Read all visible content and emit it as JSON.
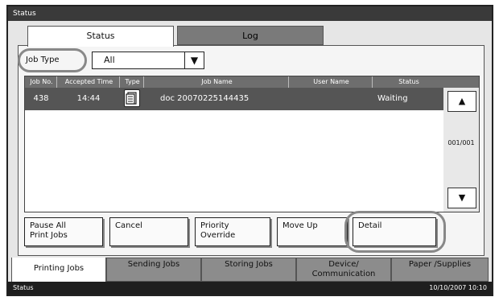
{
  "title": "Status",
  "tabs": [
    {
      "label": "Status",
      "active": true
    },
    {
      "label": "Log",
      "active": false
    }
  ],
  "filter": {
    "label": "Job Type",
    "value": "All",
    "arrow": "▼"
  },
  "table": {
    "headers": [
      "Job No.",
      "Accepted Time",
      "Type",
      "Job Name",
      "User Name",
      "Status"
    ],
    "rows": [
      {
        "job_no": "438",
        "time": "14:44",
        "type_icon": "document-icon",
        "job_name": "doc 20070225144435",
        "user": "",
        "status": "Waiting"
      }
    ]
  },
  "scroll": {
    "up": "▲",
    "down": "▼",
    "page": "001/001"
  },
  "actions": {
    "pause_all": "Pause All\nPrint Jobs",
    "cancel": "Cancel",
    "priority": "Priority\nOverride",
    "move_up": "Move Up",
    "detail": "Detail"
  },
  "bottom_tabs": [
    {
      "label": "Printing Jobs",
      "active": true
    },
    {
      "label": "Sending Jobs",
      "active": false
    },
    {
      "label": "Storing Jobs",
      "active": false
    },
    {
      "label": "Device/\nCommunication",
      "active": false
    },
    {
      "label": "Paper /Supplies",
      "active": false
    }
  ],
  "statusbar": {
    "left": "Status",
    "datetime": "10/10/2007   10:10"
  },
  "colors": {
    "titlebar": "#3a3a3a",
    "selected_row": "#555555",
    "inactive_tab": "#7a7a7a"
  }
}
